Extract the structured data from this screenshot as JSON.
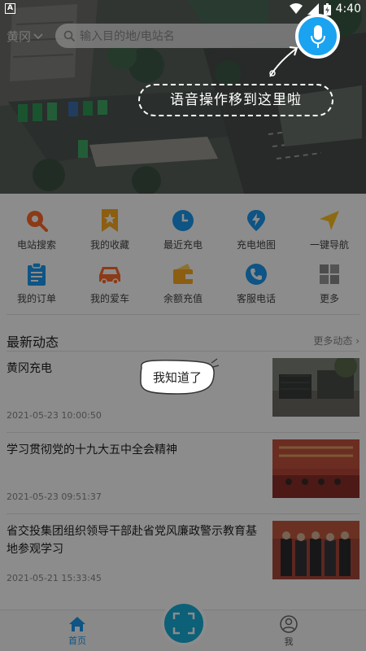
{
  "status_bar": {
    "time": "4:40",
    "badge": "A"
  },
  "header": {
    "city": "黄冈",
    "search_placeholder": "输入目的地/电站名"
  },
  "tips": {
    "voice": "语音操作移到这里啦",
    "got_it": "我知道了"
  },
  "grid": [
    [
      {
        "label": "电站搜索",
        "icon": "station-search-icon",
        "color": "#ff6a2b"
      },
      {
        "label": "我的收藏",
        "icon": "favorite-star-icon",
        "color": "#ffab1f"
      },
      {
        "label": "最近充电",
        "icon": "clock-icon",
        "color": "#1a9af0"
      },
      {
        "label": "充电地图",
        "icon": "map-pin-icon",
        "color": "#1a9af0"
      },
      {
        "label": "一键导航",
        "icon": "navigation-arrow-icon",
        "color": "#ffc21f"
      }
    ],
    [
      {
        "label": "我的订单",
        "icon": "clipboard-icon",
        "color": "#1a9af0"
      },
      {
        "label": "我的爱车",
        "icon": "car-icon",
        "color": "#ff6a2b"
      },
      {
        "label": "余额充值",
        "icon": "wallet-icon",
        "color": "#ffab1f"
      },
      {
        "label": "客服电话",
        "icon": "phone-icon",
        "color": "#1a9af0"
      },
      {
        "label": "更多",
        "icon": "more-grid-icon",
        "color": "#8a8a8a"
      }
    ]
  ],
  "news": {
    "title": "最新动态",
    "more": "更多动态",
    "items": [
      {
        "title": "黄冈充电",
        "date": "2021-05-23 10:00:50"
      },
      {
        "title": "学习贯彻党的十九大五中全会精神",
        "date": "2021-05-23 09:51:37"
      },
      {
        "title": "省交投集团组织领导干部赴省党风廉政警示教育基地参观学习",
        "date": "2021-05-21 15:33:45"
      }
    ]
  },
  "tabs": {
    "home": "首页",
    "me": "我"
  },
  "colors": {
    "accent": "#1aa3f0",
    "tab_active": "#1a9af0",
    "scan": "#16b0d9"
  }
}
